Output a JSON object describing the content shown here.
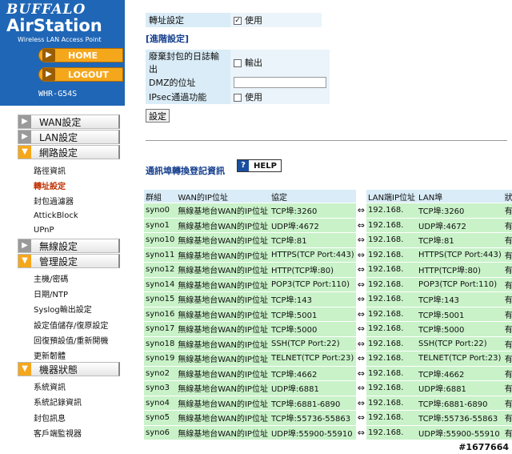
{
  "brand": {
    "buffalo": "BUFFALO",
    "product": "AirStation",
    "tagline": "Wireless LAN Access Point",
    "model": "WHR-G54S"
  },
  "nav": {
    "home": "HOME",
    "logout": "LOGOUT"
  },
  "menu": {
    "wan": "WAN設定",
    "lan": "LAN設定",
    "network": "網路設定",
    "network_items": [
      "路徑資訊",
      "轉址設定",
      "封包過濾器",
      "AttickBlock",
      "UPnP"
    ],
    "wireless": "無線設定",
    "admin": "管理設定",
    "admin_items": [
      "主機/密碼",
      "日期/NTP",
      "Syslog輸出設定",
      "設定值儲存/復原設定",
      "回復預設值/重新開機",
      "更新韌體"
    ],
    "status": "機器狀態",
    "status_items": [
      "系統資訊",
      "系統記錄資訊",
      "封包訊息",
      "客戶端監視器"
    ]
  },
  "form": {
    "forward_label": "轉址設定",
    "forward_value": "使用",
    "advanced_title": "[進階設定]",
    "drop_log_label": "廢棄封包的日誌輸出",
    "drop_log_value": "輸出",
    "dmz_label": "DMZ的位址",
    "dmz_value": "",
    "ipsec_label": "IPsec通過功能",
    "ipsec_value": "使用",
    "set_button": "設定"
  },
  "registry": {
    "title": "通訊埠轉換登記資訊",
    "help": "HELP",
    "headers": [
      "群組",
      "WAN的IP位址",
      "協定",
      "",
      "LAN端IP位址",
      "LAN埠",
      "狀態"
    ],
    "arrow": "⇔",
    "rows": [
      [
        "syno0",
        "無線基地台WAN的IP位址",
        "TCP埠:3260",
        "192.168.",
        "TCP埠:3260",
        "有效"
      ],
      [
        "syno1",
        "無線基地台WAN的IP位址",
        "UDP埠:4672",
        "192.168.",
        "UDP埠:4672",
        "有效"
      ],
      [
        "syno10",
        "無線基地台WAN的IP位址",
        "TCP埠:81",
        "192.168.",
        "TCP埠:81",
        "有效"
      ],
      [
        "syno11",
        "無線基地台WAN的IP位址",
        "HTTPS(TCP Port:443)",
        "192.168.",
        "HTTPS(TCP Port:443)",
        "有效"
      ],
      [
        "syno12",
        "無線基地台WAN的IP位址",
        "HTTP(TCP埠:80)",
        "192.168.",
        "HTTP(TCP埠:80)",
        "有效"
      ],
      [
        "syno14",
        "無線基地台WAN的IP位址",
        "POP3(TCP Port:110)",
        "192.168.",
        "POP3(TCP Port:110)",
        "有效"
      ],
      [
        "syno15",
        "無線基地台WAN的IP位址",
        "TCP埠:143",
        "192.168.",
        "TCP埠:143",
        "有效"
      ],
      [
        "syno16",
        "無線基地台WAN的IP位址",
        "TCP埠:5001",
        "192.168.",
        "TCP埠:5001",
        "有效"
      ],
      [
        "syno17",
        "無線基地台WAN的IP位址",
        "TCP埠:5000",
        "192.168.",
        "TCP埠:5000",
        "有效"
      ],
      [
        "syno18",
        "無線基地台WAN的IP位址",
        "SSH(TCP Port:22)",
        "192.168.",
        "SSH(TCP Port:22)",
        "有效"
      ],
      [
        "syno19",
        "無線基地台WAN的IP位址",
        "TELNET(TCP Port:23)",
        "192.168.",
        "TELNET(TCP Port:23)",
        "有效"
      ],
      [
        "syno2",
        "無線基地台WAN的IP位址",
        "TCP埠:4662",
        "192.168.",
        "TCP埠:4662",
        "有效"
      ],
      [
        "syno3",
        "無線基地台WAN的IP位址",
        "UDP埠:6881",
        "192.168.",
        "UDP埠:6881",
        "有效"
      ],
      [
        "syno4",
        "無線基地台WAN的IP位址",
        "TCP埠:6881-6890",
        "192.168.",
        "TCP埠:6881-6890",
        "有效"
      ],
      [
        "syno5",
        "無線基地台WAN的IP位址",
        "TCP埠:55736-55863",
        "192.168.",
        "TCP埠:55736-55863",
        "有效"
      ],
      [
        "syno6",
        "無線基地台WAN的IP位址",
        "UDP埠:55900-55910",
        "192.168.",
        "UDP埠:55900-55910",
        "有效"
      ]
    ]
  },
  "watermark": "#1677664",
  "colors": {
    "brand_blue": "#1f66b6",
    "accent_orange": "#f5a71c",
    "label_bg": "#d9ecf7",
    "row_green": "#c9f2c9",
    "current_link": "#c03000"
  }
}
